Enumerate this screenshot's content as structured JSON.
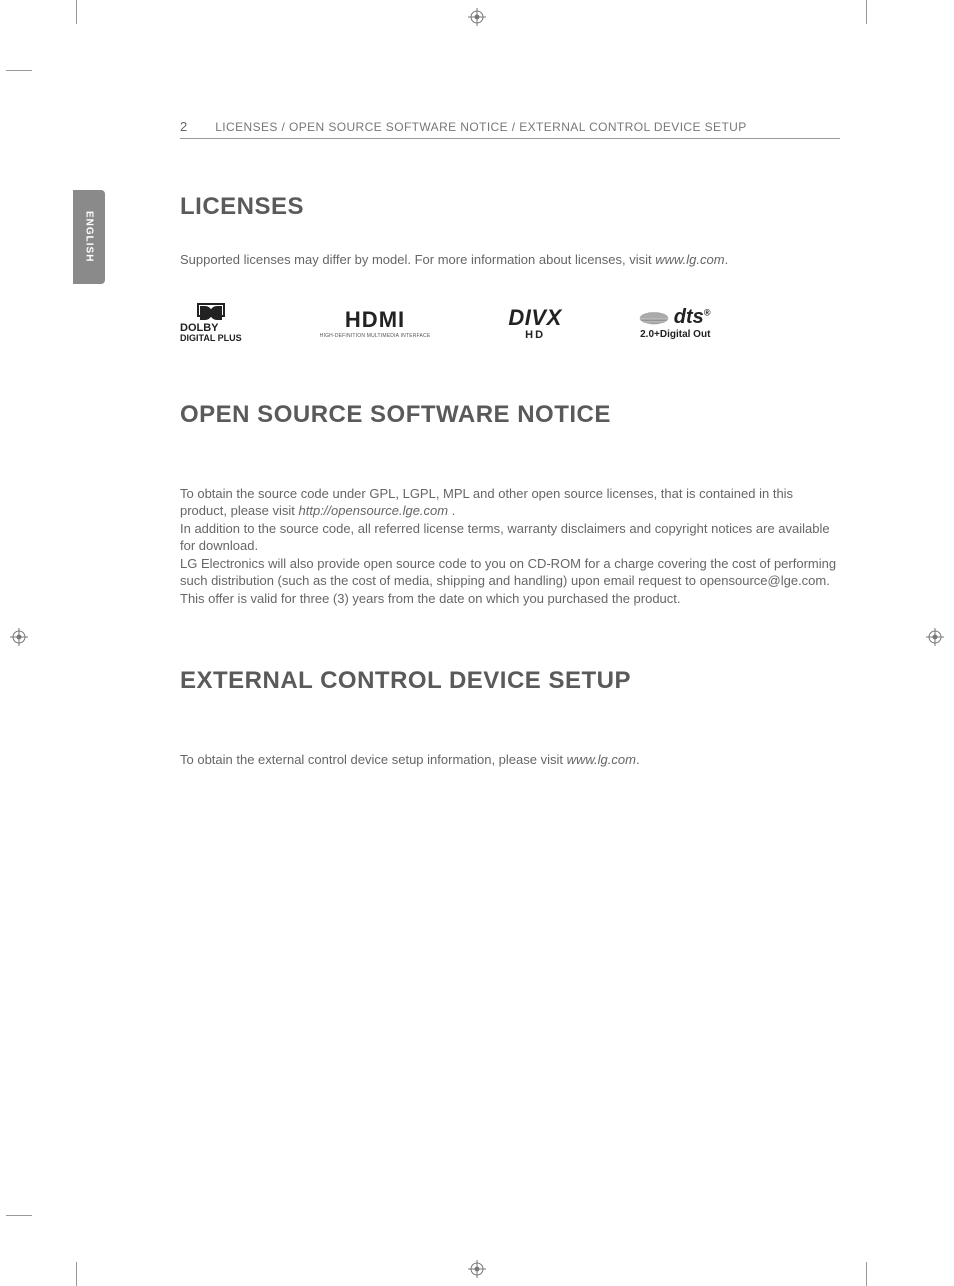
{
  "header": {
    "page_number": "2",
    "title": "LICENSES / OPEN SOURCE SOFTWARE NOTICE / EXTERNAL CONTROL DEVICE SETUP"
  },
  "tab": {
    "language": "ENGLISH"
  },
  "sections": {
    "licenses": {
      "heading": "LICENSES",
      "intro_pre": "Supported licenses may differ by model. For more information about licenses, visit ",
      "intro_link": "www.lg.com",
      "intro_post": ".",
      "logos": {
        "dolby": {
          "line1": "DOLBY",
          "line2": "DIGITAL PLUS"
        },
        "hdmi": {
          "main": "HDMI",
          "sub": "HIGH-DEFINITION MULTIMEDIA INTERFACE"
        },
        "divx": {
          "main": "DIVX",
          "sub": "HD"
        },
        "dts": {
          "main": "dts",
          "trade": "®",
          "sub": "2.0+Digital Out"
        }
      }
    },
    "oss": {
      "heading": "OPEN SOURCE SOFTWARE NOTICE",
      "p1_pre": "To obtain the source code under GPL, LGPL, MPL and other open source licenses, that is contained in this product, please visit ",
      "p1_link": "http://opensource.lge.com",
      "p1_post": " .",
      "p2": "In addition to the source code, all referred license terms, warranty disclaimers and copyright notices are available for download.",
      "p3": "LG Electronics will also provide open source code to you on CD-ROM for a charge covering the cost of performing such distribution (such as the cost of media, shipping and handling) upon email request to opensource@lge.com. This offer is valid for three (3) years from the date on which you purchased the product."
    },
    "external": {
      "heading": "EXTERNAL CONTROL DEVICE SETUP",
      "p_pre": "To obtain the external control device setup information, please visit ",
      "p_link": "www.lg.com",
      "p_post": "."
    }
  }
}
